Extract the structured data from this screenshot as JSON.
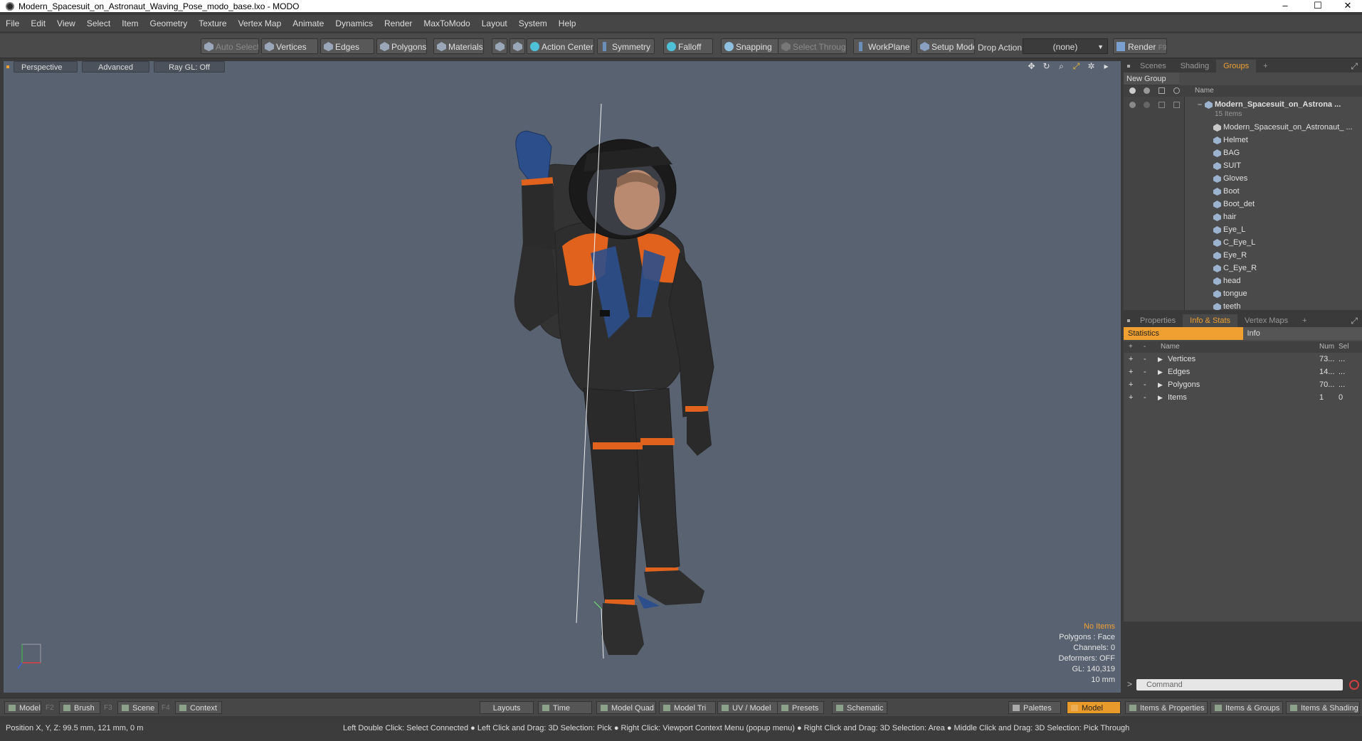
{
  "window": {
    "title": "Modern_Spacesuit_on_Astronaut_Waving_Pose_modo_base.lxo - MODO",
    "minimize": "–",
    "maximize": "☐",
    "close": "✕"
  },
  "menu": [
    "File",
    "Edit",
    "View",
    "Select",
    "Item",
    "Geometry",
    "Texture",
    "Vertex Map",
    "Animate",
    "Dynamics",
    "Render",
    "MaxToModo",
    "Layout",
    "System",
    "Help"
  ],
  "toolbar": {
    "auto_select": "Auto Select",
    "vertices": "Vertices",
    "edges": "Edges",
    "polygons": "Polygons",
    "materials": "Materials",
    "action_center": "Action Center",
    "symmetry": "Symmetry",
    "falloff": "Falloff",
    "snapping": "Snapping",
    "select_through": "Select Through",
    "workplane": "WorkPlane",
    "setup_mode": "Setup Mode",
    "drop_action": "Drop Action",
    "drop_value": "(none)",
    "render": "Render",
    "render_key": "F9"
  },
  "viewport": {
    "tabs": [
      "Perspective",
      "Advanced",
      "Ray GL: Off"
    ],
    "stats": {
      "items": "No Items",
      "polygons": "Polygons : Face",
      "channels": "Channels: 0",
      "deformers": "Deformers: OFF",
      "gl": "GL: 140,319",
      "scale": "10 mm"
    }
  },
  "groups_panel": {
    "tabs": [
      "Scenes",
      "Shading",
      "Groups"
    ],
    "active": "Groups",
    "new_group": "New Group",
    "name_col": "Name",
    "root": "Modern_Spacesuit_on_Astrona ...",
    "root_count": "15 Items",
    "items": [
      "Modern_Spacesuit_on_Astronaut_ ...",
      "Helmet",
      "BAG",
      "SUIT",
      "Gloves",
      "Boot",
      "Boot_det",
      "hair",
      "Eye_L",
      "C_Eye_L",
      "Eye_R",
      "C_Eye_R",
      "head",
      "tongue",
      "teeth"
    ]
  },
  "stats_panel": {
    "tabs": [
      "Properties",
      "Info & Stats",
      "Vertex Maps"
    ],
    "active": "Info & Stats",
    "sub_tabs": [
      "Statistics",
      "Info"
    ],
    "col_name": "Name",
    "col_num": "Num",
    "col_sel": "Sel",
    "rows": [
      {
        "name": "Vertices",
        "num": "73...",
        "sel": "..."
      },
      {
        "name": "Edges",
        "num": "14...",
        "sel": "..."
      },
      {
        "name": "Polygons",
        "num": "70...",
        "sel": "..."
      },
      {
        "name": "Items",
        "num": "1",
        "sel": "0"
      }
    ]
  },
  "command": {
    "placeholder": "Command"
  },
  "bottombar": {
    "model": "Model",
    "f2": "F2",
    "brush": "Brush",
    "f3": "F3",
    "scene": "Scene",
    "f4": "F4",
    "context": "Context",
    "layouts": "Layouts",
    "time": "Time",
    "model_quad": "Model Quad",
    "model_tri": "Model Tri",
    "uv_model": "UV / Model",
    "presets": "Presets",
    "schematic": "Schematic",
    "palettes": "Palettes",
    "model_active": "Model",
    "items_properties": "Items & Properties",
    "items_groups": "Items & Groups",
    "items_shading": "Items & Shading"
  },
  "status": {
    "position": "Position X, Y, Z:  99.5 mm, 121 mm, 0 m",
    "hints": "Left Double Click: Select Connected ● Left Click and Drag: 3D Selection: Pick ● Right Click: Viewport Context Menu (popup menu) ● Right Click and Drag: 3D Selection: Area ● Middle Click and Drag: 3D Selection: Pick Through"
  },
  "colors": {
    "accent": "#f0a030",
    "viewport_bg": "#596271",
    "suit_dark": "#2b2b2b",
    "suit_orange": "#e0621c",
    "suit_blue": "#2c4f8c"
  }
}
